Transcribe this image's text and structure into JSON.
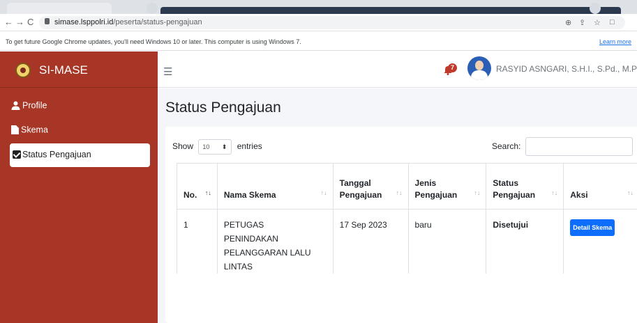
{
  "browser": {
    "url_host": "simase.lsppolri.id",
    "url_path": "/peserta/status-pengajuan",
    "update_message": "To get future Google Chrome updates, you'll need Windows 10 or later. This computer is using Windows 7.",
    "learn_more": "Learn more"
  },
  "sidebar": {
    "brand": "SI-MASE",
    "items": [
      {
        "label": "Profile",
        "icon": "user-icon"
      },
      {
        "label": "Skema",
        "icon": "file-icon"
      },
      {
        "label": "Status Pengajuan",
        "icon": "check-square-icon",
        "active": true
      }
    ]
  },
  "topbar": {
    "notification_count": "7",
    "username": "RASYID ASNGARI, S.H.I., S.Pd., M.Pd."
  },
  "page": {
    "title": "Status Pengajuan",
    "show_label": "Show",
    "entries_value": "10",
    "entries_label": "entries",
    "search_label": "Search:"
  },
  "table": {
    "headers": [
      "No.",
      "Nama Skema",
      "Tanggal Pengajuan",
      "Jenis Pengajuan",
      "Status Pengajuan",
      "Aksi"
    ],
    "rows": [
      {
        "no": "1",
        "nama_skema": "PETUGAS PENINDAKAN PELANGGARAN LALU LINTAS",
        "tanggal": "17 Sep 2023",
        "jenis": "baru",
        "status": "Disetujui",
        "aksi": "Detail Skema"
      }
    ]
  },
  "colors": {
    "sidebar_bg": "#a73626",
    "primary_button": "#0d6efd",
    "badge": "#c0392b"
  }
}
